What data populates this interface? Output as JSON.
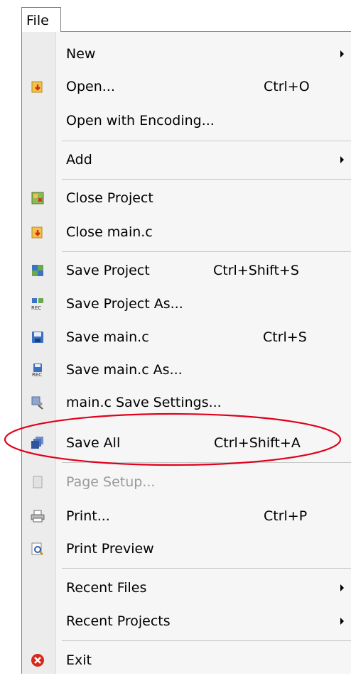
{
  "menubar": {
    "file_label": "File"
  },
  "menu": {
    "items": [
      {
        "label": "New",
        "shortcut": "",
        "submenu": true,
        "icon": "none"
      },
      {
        "label": "Open...",
        "shortcut": "Ctrl+O",
        "submenu": false,
        "icon": "open-folder-icon"
      },
      {
        "label": "Open with Encoding...",
        "shortcut": "",
        "submenu": false,
        "icon": "none"
      },
      {
        "label": "Add",
        "shortcut": "",
        "submenu": true,
        "icon": "none"
      },
      {
        "label": "Close Project",
        "shortcut": "",
        "submenu": false,
        "icon": "close-project-icon"
      },
      {
        "label": "Close main.c",
        "shortcut": "",
        "submenu": false,
        "icon": "close-file-icon"
      },
      {
        "label": "Save Project",
        "shortcut": "Ctrl+Shift+S",
        "submenu": false,
        "icon": "save-project-icon"
      },
      {
        "label": "Save Project As...",
        "shortcut": "",
        "submenu": false,
        "icon": "save-project-as-icon"
      },
      {
        "label": "Save main.c",
        "shortcut": "Ctrl+S",
        "submenu": false,
        "icon": "save-icon"
      },
      {
        "label": "Save main.c As...",
        "shortcut": "",
        "submenu": false,
        "icon": "save-as-icon"
      },
      {
        "label": "main.c Save Settings...",
        "shortcut": "",
        "submenu": false,
        "icon": "save-settings-icon"
      },
      {
        "label": "Save All",
        "shortcut": "Ctrl+Shift+A",
        "submenu": false,
        "icon": "save-all-icon"
      },
      {
        "label": "Page Setup...",
        "shortcut": "",
        "submenu": false,
        "icon": "page-setup-icon",
        "disabled": true
      },
      {
        "label": "Print...",
        "shortcut": "Ctrl+P",
        "submenu": false,
        "icon": "printer-icon"
      },
      {
        "label": "Print Preview",
        "shortcut": "",
        "submenu": false,
        "icon": "print-preview-icon"
      },
      {
        "label": "Recent Files",
        "shortcut": "",
        "submenu": true,
        "icon": "none"
      },
      {
        "label": "Recent Projects",
        "shortcut": "",
        "submenu": true,
        "icon": "none"
      },
      {
        "label": "Exit",
        "shortcut": "",
        "submenu": false,
        "icon": "exit-icon"
      }
    ]
  },
  "annotation": {
    "highlighted_item": "Save All",
    "highlight_color": "#e0001b"
  }
}
